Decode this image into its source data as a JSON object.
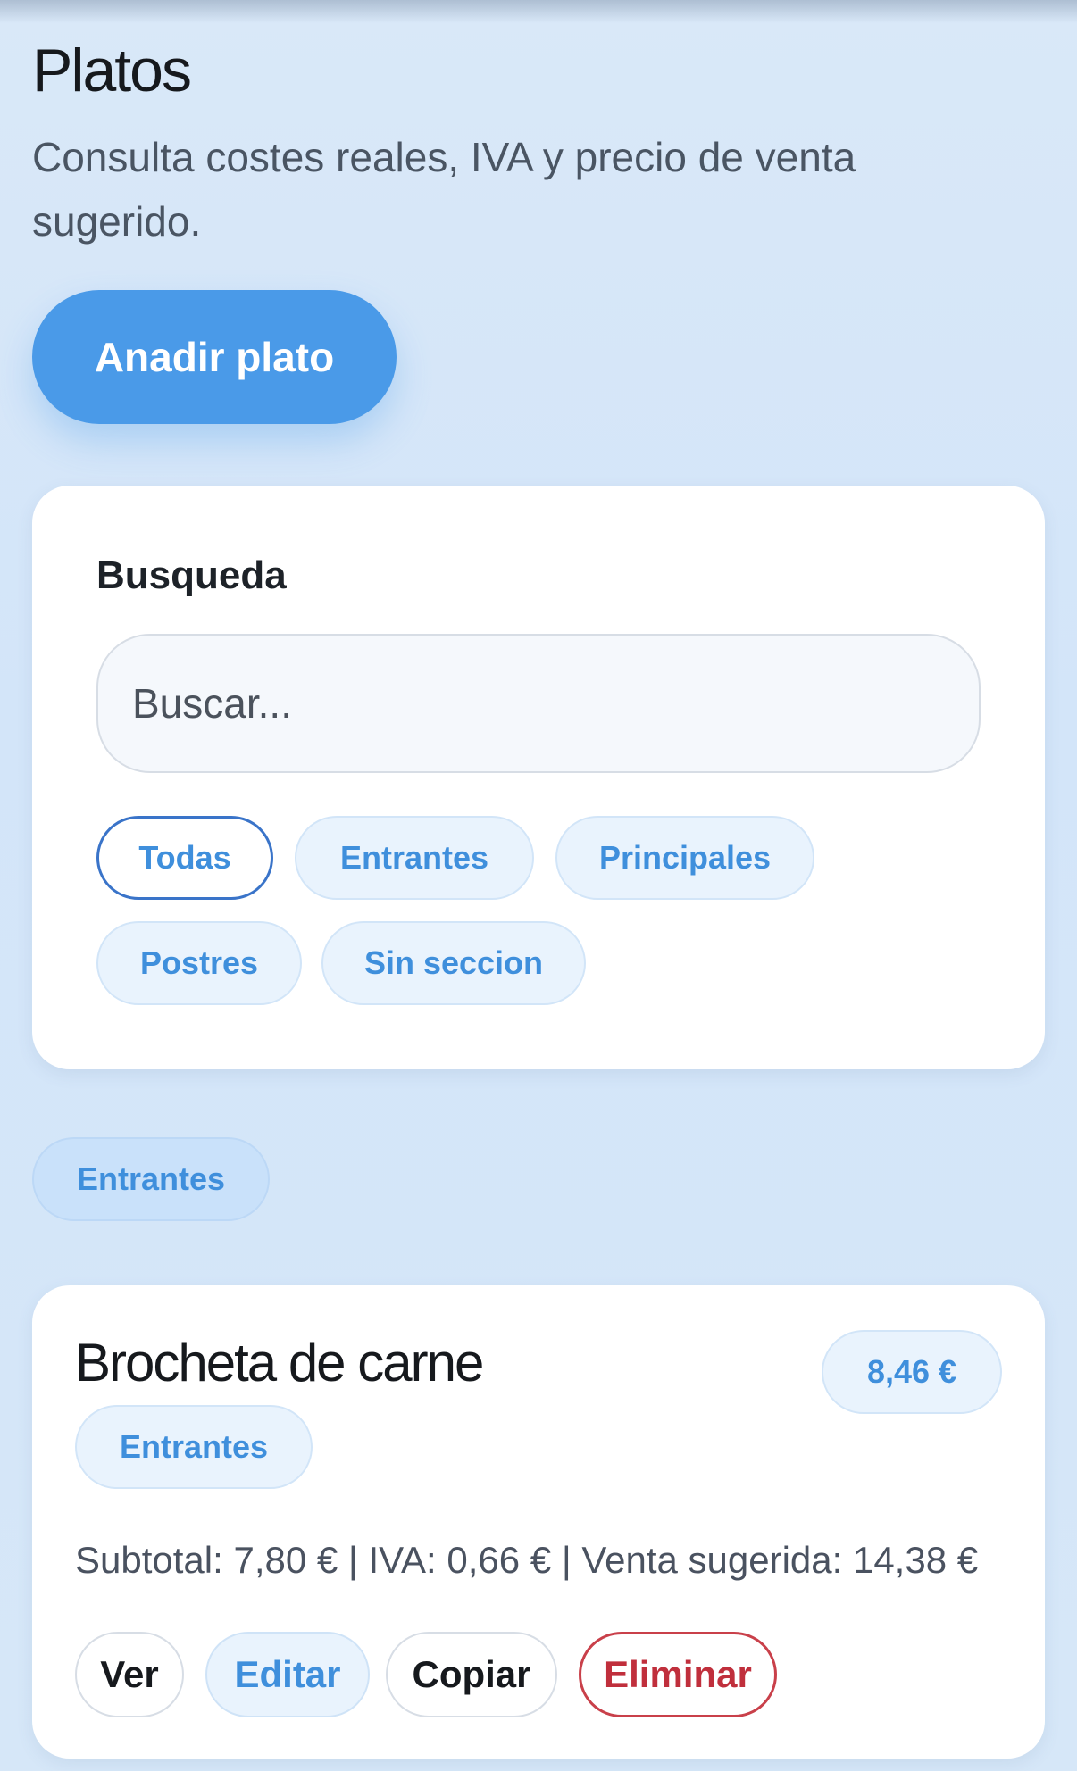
{
  "header": {
    "title": "Platos",
    "subtitle": "Consulta costes reales, IVA y precio de venta sugerido."
  },
  "actions": {
    "add_label": "Anadir plato"
  },
  "search": {
    "label": "Busqueda",
    "placeholder": "Buscar...",
    "value": "",
    "filters": [
      "Todas",
      "Entrantes",
      "Principales",
      "Postres",
      "Sin seccion"
    ],
    "active_filter": "Todas"
  },
  "section": {
    "label": "Entrantes"
  },
  "dishes": [
    {
      "name": "Brocheta de carne",
      "price": "8,46 €",
      "section": "Entrantes",
      "summary": "Subtotal: 7,80 € | IVA: 0,66 € | Venta sugerida: 14,38 €",
      "buttons": {
        "view": "Ver",
        "edit": "Editar",
        "copy": "Copiar",
        "delete": "Eliminar"
      }
    }
  ],
  "colors": {
    "accent": "#4a9ae8",
    "chip_text": "#3f8fdc",
    "danger": "#c02f3c",
    "background": "#d6e7f8"
  }
}
